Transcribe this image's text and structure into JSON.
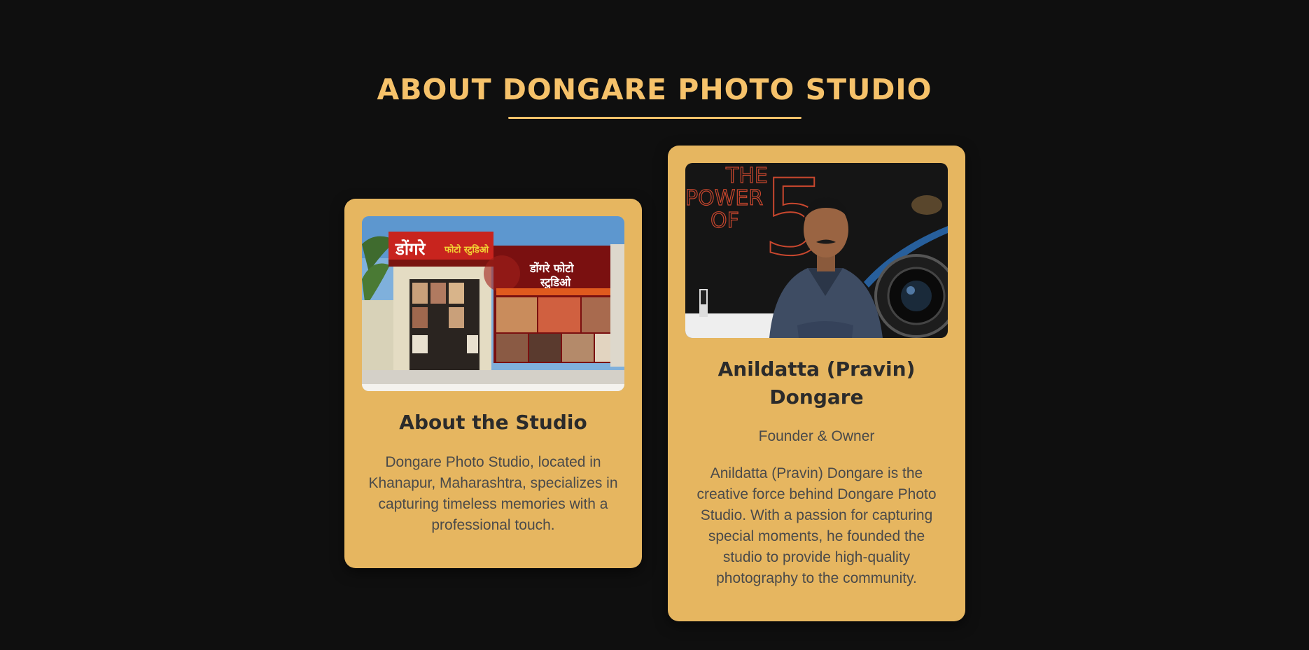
{
  "section": {
    "title": "ABOUT DONGARE PHOTO STUDIO"
  },
  "studio_card": {
    "heading": "About the Studio",
    "text": "Dongare Photo Studio, located in Khanapur, Maharashtra, specializes in capturing timeless memories with a professional touch.",
    "photo": {
      "sign_name": "डोंगरे",
      "sign_sub": "फोटो स्टुडिओ",
      "banner_title_line1": "डोंगरे फोटो",
      "banner_title_line2": "स्टुडिओ"
    }
  },
  "founder_card": {
    "heading": "Anildatta (Pravin) Dongare",
    "role": "Founder & Owner",
    "text": "Anildatta (Pravin) Dongare is the creative force behind Dongare Photo Studio. With a passion for capturing special moments, he founded the studio to provide high-quality photography to the community.",
    "photo": {
      "poster_line1": "THE",
      "poster_line2": "POWER",
      "poster_line3": "OF",
      "poster_number": "5"
    }
  },
  "colors": {
    "background": "#0f0f0f",
    "accent": "#f6c26a",
    "card": "#e6b660",
    "heading_text": "#2b2b2b",
    "body_text": "#4a4a4a"
  }
}
